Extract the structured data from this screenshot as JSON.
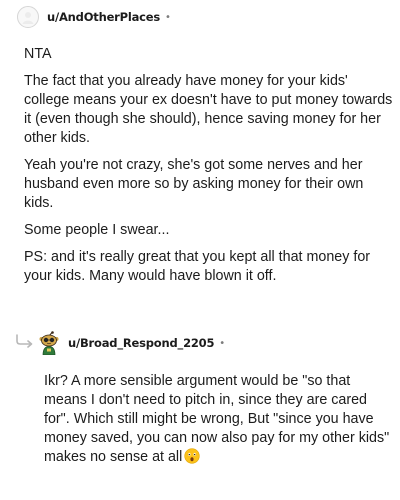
{
  "comments": [
    {
      "username": "u/AndOtherPlaces",
      "meta_separator": "•",
      "paragraphs": [
        "NTA",
        "The fact that you already have money for your kids' college means your ex doesn't have to put money towards it (even though she should), hence saving money for her other kids.",
        "Yeah you're not crazy, she's got some nerves and her husband even more so by asking money for their own kids.",
        "Some people I swear...",
        "PS: and it's really great that you kept all that money for your kids. Many would have blown it off."
      ],
      "avatar_icon": "default-avatar-icon"
    },
    {
      "username": "u/Broad_Respond_2205",
      "meta_separator": "•",
      "is_reply": true,
      "reply_icon": "reply-arrow-icon",
      "avatar_icon": "snoo-avatar-icon",
      "text": "Ikr? A more sensible argument would be \"so that means I don't need to pitch in, since they are cared for\". Which still might be wrong, But \"since you have money saved, you can now also pay for my other kids\" makes no sense at all",
      "trailing_emoji": "astonished-face-emoji"
    }
  ],
  "colors": {
    "text": "#1c1c1c",
    "meta": "#7c7c7c",
    "reply_line": "#b8b8b8"
  }
}
